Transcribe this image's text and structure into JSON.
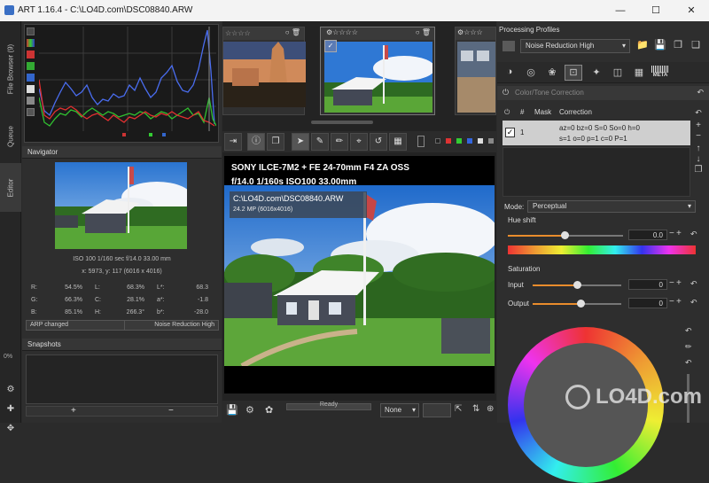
{
  "window": {
    "title": "ART 1.16.4 - C:\\LO4D.com\\DSC08840.ARW"
  },
  "left_tabs": [
    "File Browser (9)",
    "Queue",
    "Editor"
  ],
  "left_tab_percent": "0%",
  "navigator": {
    "title": "Navigator",
    "exif_line": "ISO 100   1/160 sec   f/14.0   33.00 mm",
    "coords": "x: 5973, y: 117  (6016 x 4016)",
    "values": [
      {
        "a": "R:",
        "av": "54.5%",
        "b": "L:",
        "bv": "68.3%",
        "c": "L*:",
        "cv": "68.3"
      },
      {
        "a": "G:",
        "av": "66.3%",
        "b": "C:",
        "bv": "28.1%",
        "c": "a*:",
        "cv": "-1.8"
      },
      {
        "a": "B:",
        "av": "85.1%",
        "b": "H:",
        "bv": "266.3°",
        "c": "b*:",
        "cv": "-28.0"
      }
    ],
    "history_left": "ARP changed",
    "history_right": "Noise Reduction High"
  },
  "snapshots": {
    "title": "Snapshots",
    "add": "+",
    "remove": "−"
  },
  "preview": {
    "camera": "SONY ILCE-7M2  +  FE 24-70mm F4 ZA OSS",
    "exposure": "f/14.0   1/160s   ISO100   33.00mm",
    "file": "C:\\LO4D.com\\DSC08840.ARW",
    "size": "24.2 MP (6016x4016)",
    "status": "Ready",
    "dropdown": "None"
  },
  "right": {
    "profiles_title": "Processing Profiles",
    "profile": "Noise Reduction High",
    "tool_title": "Color/Tone Correction",
    "table_headers": [
      "#",
      "Mask",
      "Correction"
    ],
    "row": {
      "num": "1",
      "line1": "az=0 bz=0 S=0 So=0 h=0",
      "line2": "s=1 o=0 p=1 c=0 P=1"
    },
    "mode_label": "Mode:",
    "mode_value": "Perceptual",
    "hue_shift_label": "Hue shift",
    "hue_shift_value": "0.0",
    "saturation_label": "Saturation",
    "input_label": "Input",
    "input_value": "0",
    "output_label": "Output",
    "output_value": "0",
    "tab_meta": "META"
  },
  "watermark": "LO4D.com",
  "colors": {
    "accent": "#6a9bd1",
    "selection": "#cfcfcf"
  }
}
